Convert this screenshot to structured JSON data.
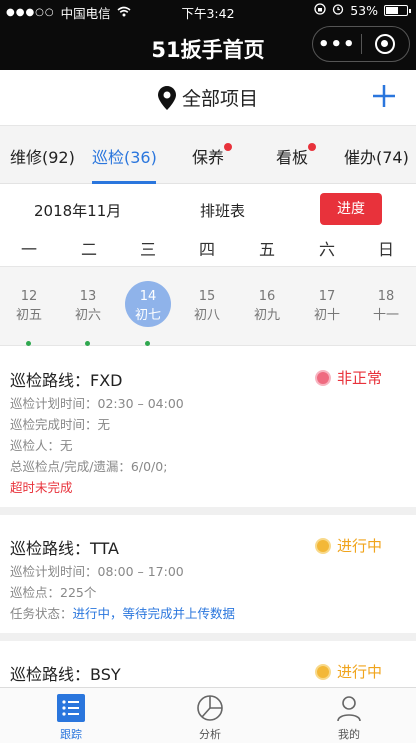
{
  "status_bar": {
    "carrier": "中国电信",
    "time": "下午3:42",
    "battery": "53%"
  },
  "nav": {
    "title": "51扳手首页",
    "more_icon": "more-dots-icon",
    "close_icon": "target-circle-icon"
  },
  "project": {
    "title": "全部项目",
    "pin_icon": "location-pin-icon",
    "add_icon": "plus-icon"
  },
  "tabs": [
    {
      "label": "维修(92)",
      "active": false,
      "badge": false
    },
    {
      "label": "巡检(36)",
      "active": true,
      "badge": false
    },
    {
      "label": "保养",
      "active": false,
      "badge": true
    },
    {
      "label": "看板",
      "active": false,
      "badge": true
    },
    {
      "label": "催办(74)",
      "active": false,
      "badge": false
    }
  ],
  "calendar": {
    "month": "2018年11月",
    "schedule_label": "排班表",
    "progress_button": "进度",
    "weekdays": [
      "一",
      "二",
      "三",
      "四",
      "五",
      "六",
      "日"
    ],
    "days": [
      {
        "num": "12",
        "lunar": "初五",
        "dot": true,
        "selected": false
      },
      {
        "num": "13",
        "lunar": "初六",
        "dot": true,
        "selected": false
      },
      {
        "num": "14",
        "lunar": "初七",
        "dot": true,
        "selected": true
      },
      {
        "num": "15",
        "lunar": "初八",
        "dot": false,
        "selected": false
      },
      {
        "num": "16",
        "lunar": "初九",
        "dot": false,
        "selected": false
      },
      {
        "num": "17",
        "lunar": "初十",
        "dot": false,
        "selected": false
      },
      {
        "num": "18",
        "lunar": "十一",
        "dot": false,
        "selected": false
      }
    ]
  },
  "cards": [
    {
      "route": "巡检路线：FXD",
      "status": "非正常",
      "lines": [
        "巡检计划时间：02:30 – 04:00",
        "巡检完成时间：无",
        "巡检人：无",
        "总巡检点/完成/遗漏：6/0/0;"
      ],
      "warning": "超时未完成"
    },
    {
      "route": "巡检路线：TTA",
      "status": "进行中",
      "lines": [
        "巡检计划时间：08:00 – 17:00",
        "巡检点：225个"
      ],
      "task_label": "任务状态：",
      "task_status": "进行中，等待完成并上传数据"
    },
    {
      "route": "巡检路线：BSY",
      "status": "进行中"
    }
  ],
  "bottom_tabs": [
    {
      "label": "跟踪",
      "icon": "list-icon",
      "active": true
    },
    {
      "label": "分析",
      "icon": "pie-chart-icon",
      "active": false
    },
    {
      "label": "我的",
      "icon": "user-icon",
      "active": false
    }
  ],
  "colors": {
    "accent": "#2a76dd",
    "alert": "#e8323b",
    "in_progress": "#f0a41c",
    "event_dot": "#2fa84f"
  }
}
